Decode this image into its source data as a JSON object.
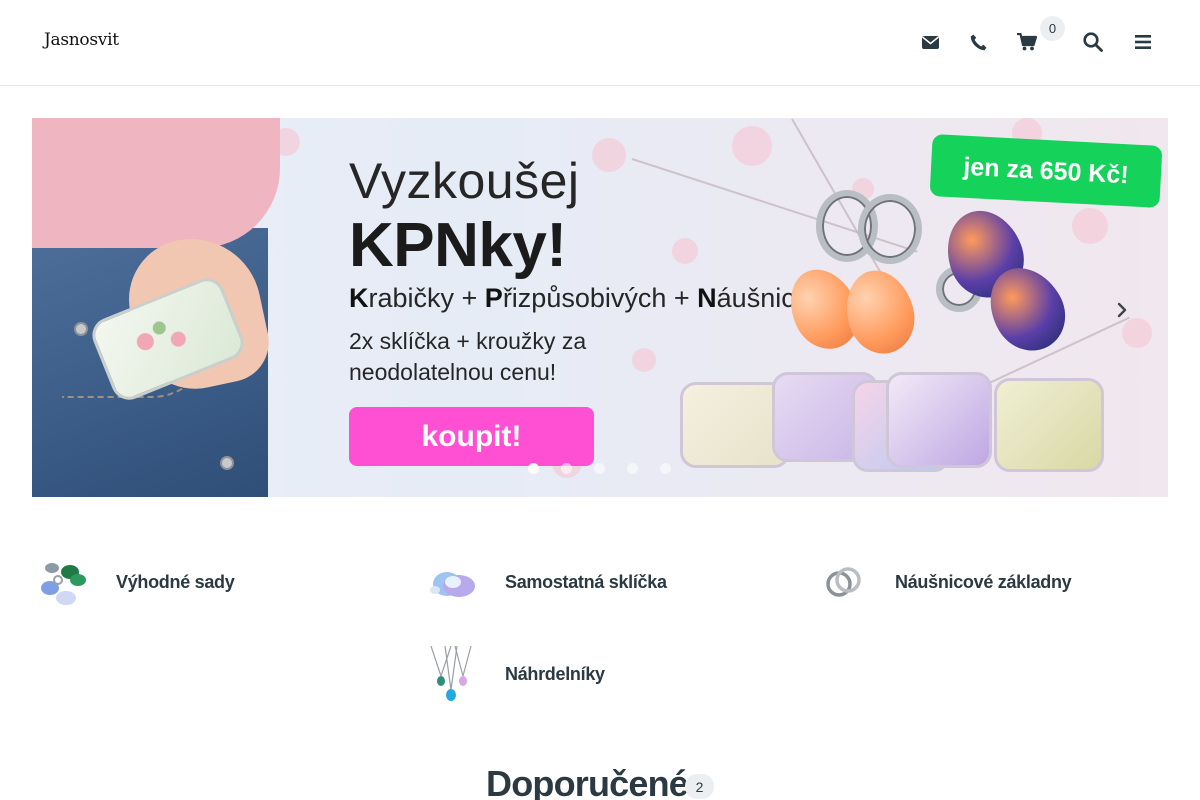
{
  "header": {
    "logo_text": "Jasnosvit",
    "icons": [
      "envelope-icon",
      "phone-icon",
      "cart-icon",
      "search-icon",
      "menu-icon"
    ],
    "cart_count": "0"
  },
  "banner": {
    "title_line1": "Vyzkoušej",
    "title_line2": "KPNky!",
    "acronym": [
      {
        "initial": "K",
        "rest": "rabičky + "
      },
      {
        "initial": "P",
        "rest": "řizpůsobivých + "
      },
      {
        "initial": "N",
        "rest": "áušnic"
      }
    ],
    "sub_line1": "2x sklíčka + kroužky za",
    "sub_line2": "neodolatelnou cenu!",
    "cta_label": "koupit!",
    "price_badge": "jen za 650 Kč!",
    "slide_count": 5,
    "active_slide": 1,
    "accent_pink": "#ff4fd3",
    "accent_green": "#15d25a"
  },
  "categories": [
    {
      "label": "Výhodné sady",
      "icon": "sets-thumbnail"
    },
    {
      "label": "Samostatná sklíčka",
      "icon": "glass-thumbnail"
    },
    {
      "label": "Náušnicové základny",
      "icon": "earring-base-thumbnail"
    },
    {
      "label": "Náhrdelníky",
      "icon": "necklace-thumbnail"
    }
  ],
  "recommended": {
    "title": "Doporučené",
    "count": "2"
  }
}
